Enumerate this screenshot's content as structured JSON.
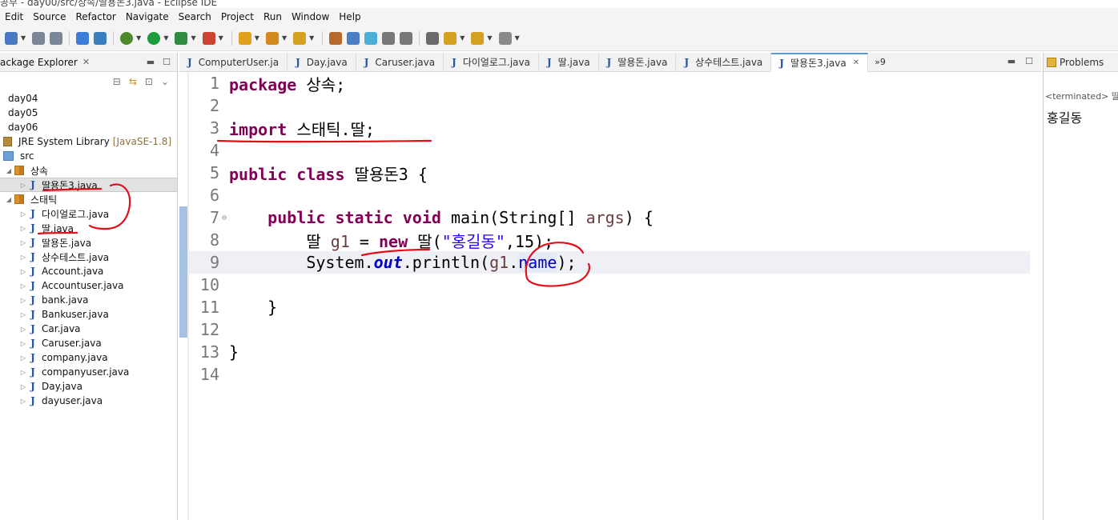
{
  "window": {
    "title": "공부 - day00/src/상속/딸용돈3.java - Eclipse IDE"
  },
  "menu": [
    "Edit",
    "Source",
    "Refactor",
    "Navigate",
    "Search",
    "Project",
    "Run",
    "Window",
    "Help"
  ],
  "toolbar": {
    "icons": [
      "new-icon",
      "save-icon",
      "save-all-icon",
      "monitor-icon",
      "skip-breakpoints-icon",
      "debug-icon",
      "run-icon",
      "coverage-icon",
      "external-tools-icon",
      "open-type-icon",
      "open-task-icon",
      "search-icon",
      "highlight-icon",
      "toggle-mark-icon",
      "word-wrap-icon",
      "block-select-icon",
      "whitespace-icon",
      "annotation-icon",
      "next-annotation-icon",
      "back-icon",
      "forward-icon"
    ]
  },
  "package_explorer": {
    "title": "ackage Explorer",
    "items": [
      {
        "label": "day04",
        "kind": "project",
        "indent": 0
      },
      {
        "label": "day05",
        "kind": "project",
        "indent": 0
      },
      {
        "label": "day06",
        "kind": "project",
        "indent": 0
      },
      {
        "label": "JRE System Library",
        "extra": "[JavaSE-1.8]",
        "kind": "library",
        "indent": 0
      },
      {
        "label": "src",
        "kind": "src",
        "indent": 0
      },
      {
        "label": "상속",
        "kind": "package",
        "indent": 1,
        "expanded": true
      },
      {
        "label": "딸용돈3.java",
        "kind": "java",
        "indent": 2,
        "selected": true
      },
      {
        "label": "스태틱",
        "kind": "package",
        "indent": 1,
        "expanded": true
      },
      {
        "label": "다이얼로그.java",
        "kind": "java",
        "indent": 2
      },
      {
        "label": "딸.java",
        "kind": "java",
        "indent": 2
      },
      {
        "label": "딸용돈.java",
        "kind": "java",
        "indent": 2
      },
      {
        "label": "상수테스트.java",
        "kind": "java",
        "indent": 2
      },
      {
        "label": "Account.java",
        "kind": "java",
        "indent": 2
      },
      {
        "label": "Accountuser.java",
        "kind": "java",
        "indent": 2
      },
      {
        "label": "bank.java",
        "kind": "java",
        "indent": 2
      },
      {
        "label": "Bankuser.java",
        "kind": "java",
        "indent": 2
      },
      {
        "label": "Car.java",
        "kind": "java",
        "indent": 2
      },
      {
        "label": "Caruser.java",
        "kind": "java",
        "indent": 2
      },
      {
        "label": "company.java",
        "kind": "java",
        "indent": 2
      },
      {
        "label": "companyuser.java",
        "kind": "java",
        "indent": 2
      },
      {
        "label": "Day.java",
        "kind": "java",
        "indent": 2
      },
      {
        "label": "dayuser.java",
        "kind": "java",
        "indent": 2
      }
    ]
  },
  "editor": {
    "tabs": [
      {
        "label": "ComputerUser.ja",
        "active": false
      },
      {
        "label": "Day.java",
        "active": false
      },
      {
        "label": "Caruser.java",
        "active": false
      },
      {
        "label": "다이얼로그.java",
        "active": false
      },
      {
        "label": "딸.java",
        "active": false
      },
      {
        "label": "딸용돈.java",
        "active": false
      },
      {
        "label": "상수테스트.java",
        "active": false
      },
      {
        "label": "딸용돈3.java",
        "active": true
      }
    ],
    "overflow": "»9",
    "lines": [
      {
        "n": "1",
        "tokens": [
          [
            "kw",
            "package"
          ],
          [
            "p",
            " 상속;"
          ]
        ]
      },
      {
        "n": "2",
        "tokens": []
      },
      {
        "n": "3",
        "tokens": [
          [
            "kw",
            "import"
          ],
          [
            "p",
            " 스태틱.딸;"
          ]
        ]
      },
      {
        "n": "4",
        "tokens": []
      },
      {
        "n": "5",
        "tokens": [
          [
            "kw",
            "public"
          ],
          [
            "p",
            " "
          ],
          [
            "kw",
            "class"
          ],
          [
            "p",
            " 딸용돈3 {"
          ]
        ]
      },
      {
        "n": "6",
        "tokens": []
      },
      {
        "n": "7",
        "fold": true,
        "tokens": [
          [
            "p",
            "    "
          ],
          [
            "kw",
            "public"
          ],
          [
            "p",
            " "
          ],
          [
            "kw",
            "static"
          ],
          [
            "p",
            " "
          ],
          [
            "kw",
            "void"
          ],
          [
            "p",
            " main(String[] "
          ],
          [
            "var",
            "args"
          ],
          [
            "p",
            ") {"
          ]
        ]
      },
      {
        "n": "8",
        "tokens": [
          [
            "p",
            "        딸 "
          ],
          [
            "var",
            "g1"
          ],
          [
            "p",
            " = "
          ],
          [
            "kw",
            "new"
          ],
          [
            "p",
            " 딸("
          ],
          [
            "str",
            "\"홍길동\""
          ],
          [
            "p",
            ",15);"
          ]
        ]
      },
      {
        "n": "9",
        "current": true,
        "tokens": [
          [
            "p",
            "        System."
          ],
          [
            "fld",
            "out"
          ],
          [
            "p",
            ".println("
          ],
          [
            "var",
            "g1"
          ],
          [
            "p",
            "."
          ],
          [
            "name",
            "name"
          ],
          [
            "p",
            ");"
          ]
        ]
      },
      {
        "n": "10",
        "tokens": []
      },
      {
        "n": "11",
        "tokens": [
          [
            "p",
            "    }"
          ]
        ]
      },
      {
        "n": "12",
        "tokens": []
      },
      {
        "n": "13",
        "tokens": [
          [
            "p",
            "}"
          ]
        ]
      },
      {
        "n": "14",
        "tokens": []
      }
    ]
  },
  "console": {
    "tab_label": "Problems",
    "terminated": "<terminated> 딸용",
    "output": "홍길동"
  },
  "annotation_color": "#e0101a"
}
